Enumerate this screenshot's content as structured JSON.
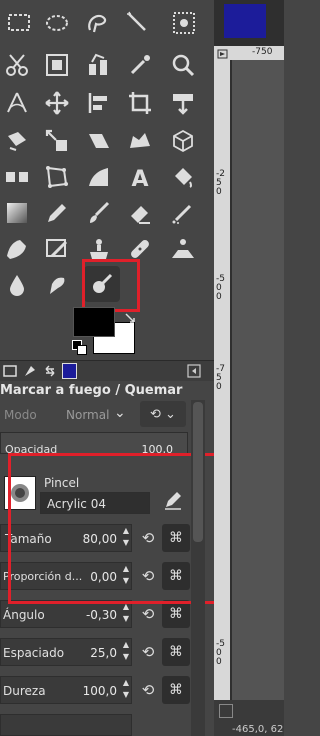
{
  "panel": {
    "title": "Marcar a fuego / Quemar",
    "mode_label": "Modo",
    "mode_value": "Normal",
    "opacity_label": "Opacidad",
    "opacity_value": "100,0"
  },
  "brush": {
    "label": "Pincel",
    "name": "Acrylic 04"
  },
  "options": [
    {
      "label": "Tamaño",
      "value": "80,00"
    },
    {
      "label": "Proporción d...",
      "value": "0,00"
    },
    {
      "label": "Ángulo",
      "value": "-0,30"
    },
    {
      "label": "Espaciado",
      "value": "25,0"
    },
    {
      "label": "Dureza",
      "value": "100,0"
    }
  ],
  "canvas": {
    "ruler_h": "-750",
    "ruler_v_1": "-250",
    "ruler_v_2": "-500",
    "ruler_v_3": "-750",
    "ruler_v_4": "-500",
    "coords": "-465,0, 62"
  },
  "colors": {
    "highlight": "#e0202a",
    "image_tab": "#1c1c9a"
  }
}
